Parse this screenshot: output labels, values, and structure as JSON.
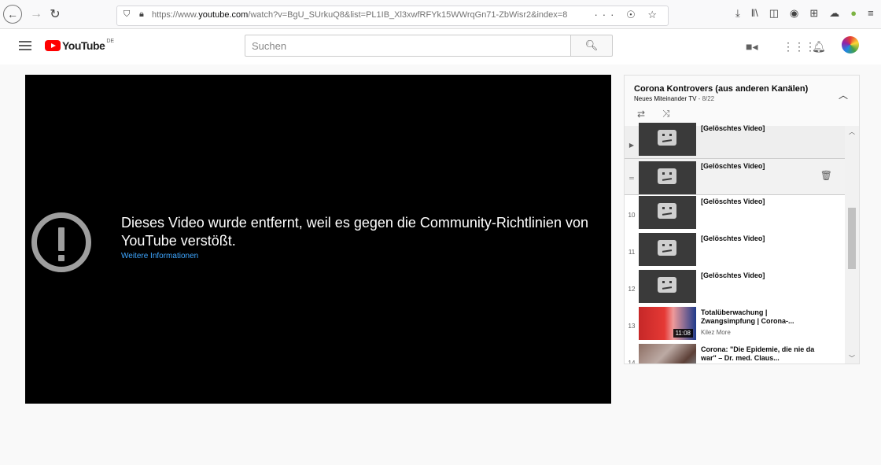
{
  "browser": {
    "url_prefix": "https://www.",
    "url_domain": "youtube.com",
    "url_path": "/watch?v=BgU_SUrkuQ8&list=PL1IB_Xl3xwfRFYk15WWrqGn71-ZbWisr2&index=8",
    "more_label": "···",
    "pocket_label": "☉",
    "star_label": "☆"
  },
  "header": {
    "logo_text": "YouTube",
    "logo_country": "DE",
    "search_placeholder": "Suchen"
  },
  "player": {
    "error_message": "Dieses Video wurde entfernt, weil es gegen die Community-Richtlinien von YouTube verstößt.",
    "more_info_link": "Weitere Informationen"
  },
  "playlist": {
    "title": "Corona Kontrovers (aus anderen Kanälen)",
    "channel": "Neues Miteinander TV",
    "separator": " - ",
    "position": "8/22",
    "items": [
      {
        "index": "▶",
        "title": "[Gelöschtes Video]",
        "channel": "",
        "duration": ""
      },
      {
        "index": "═",
        "title": "[Gelöschtes Video]",
        "channel": "",
        "duration": ""
      },
      {
        "index": "10",
        "title": "[Gelöschtes Video]",
        "channel": "",
        "duration": ""
      },
      {
        "index": "11",
        "title": "[Gelöschtes Video]",
        "channel": "",
        "duration": ""
      },
      {
        "index": "12",
        "title": "[Gelöschtes Video]",
        "channel": "",
        "duration": ""
      },
      {
        "index": "13",
        "title": "Totalüberwachung | Zwangsimpfung | Corona-...",
        "channel": "Kilez More",
        "duration": "11:08"
      },
      {
        "index": "14",
        "title": "Corona: \"Die Epidemie, die nie da war\" – Dr. med. Claus...",
        "channel": "",
        "duration": ""
      }
    ]
  }
}
